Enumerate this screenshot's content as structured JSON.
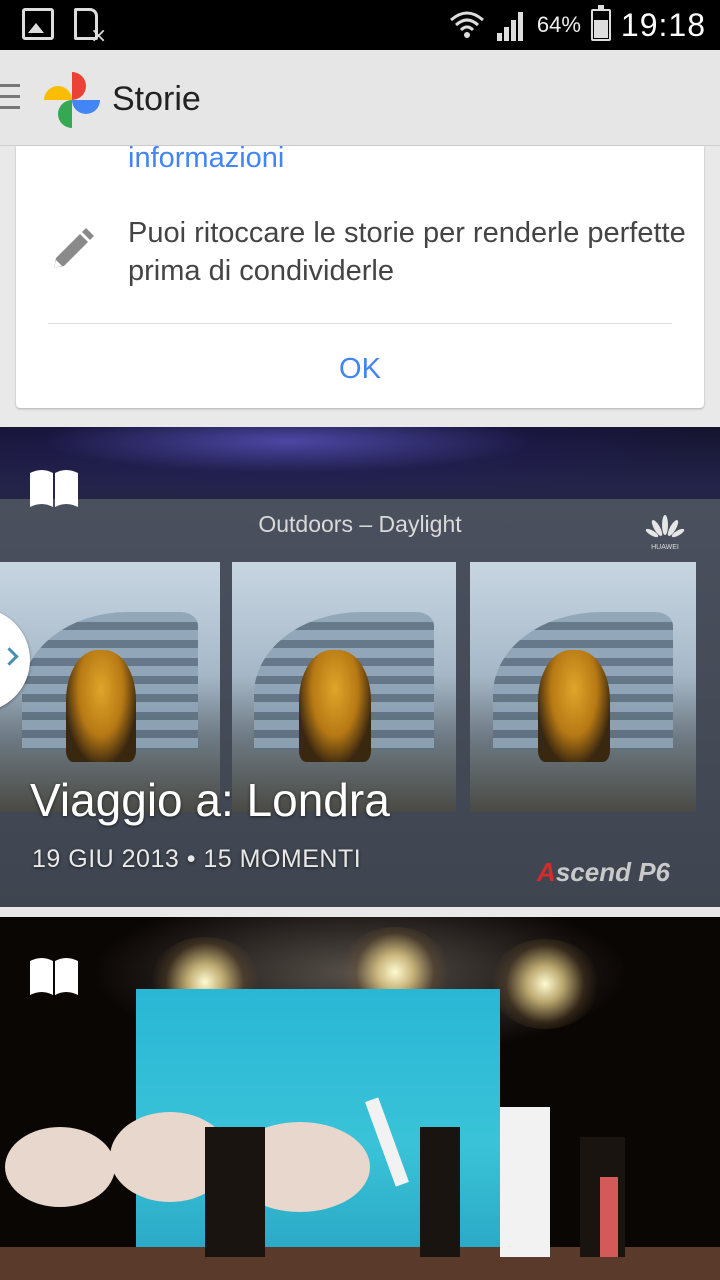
{
  "status_bar": {
    "battery_percent": "64%",
    "time": "19:18"
  },
  "app_bar": {
    "title": "Storie"
  },
  "info_card": {
    "link_text": "informazioni",
    "tip_text": "Puoi ritoccare le storie per renderle perfette prima di condividerle",
    "ok_label": "OK"
  },
  "stories": [
    {
      "title": "Viaggio a: Londra",
      "meta": "19 GIU 2013 • 15 MOMENTI",
      "slide_title": "Outdoors – Daylight",
      "brand_logo_text": "HUAWEI",
      "brand_text_a": "A",
      "brand_text_b": "scend P6"
    },
    {
      "title": ""
    }
  ],
  "colors": {
    "accent_blue": "#4285f4",
    "app_bar_bg": "#e6e6e6",
    "status_bar_bg": "#000000"
  },
  "icons": [
    "gallery-notification-icon",
    "sim-missing-icon",
    "wifi-icon",
    "signal-icon",
    "battery-icon",
    "menu-icon",
    "google-photos-logo",
    "pencil-icon",
    "story-book-icon",
    "chevron-right-icon"
  ]
}
